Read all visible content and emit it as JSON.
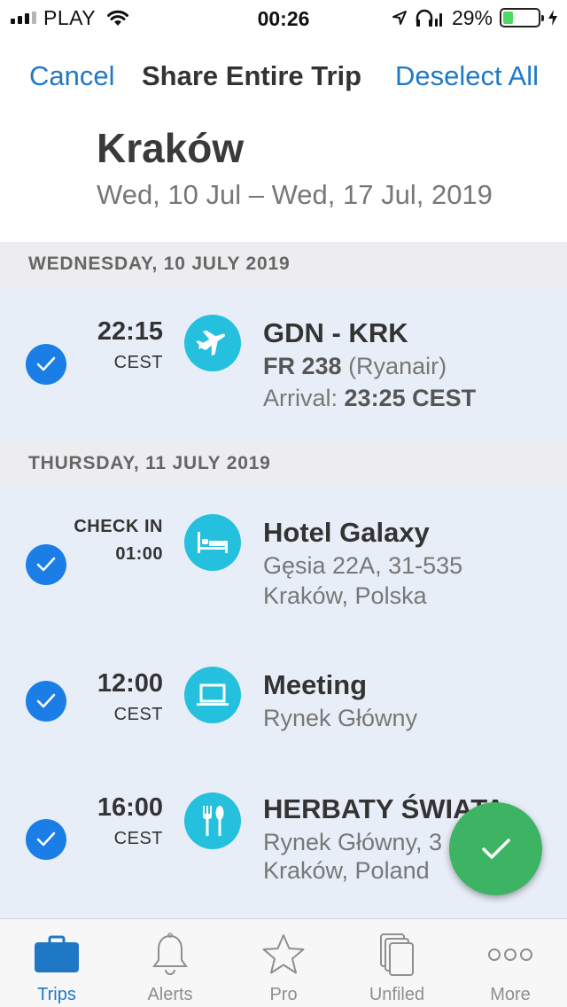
{
  "status_bar": {
    "carrier": "PLAY",
    "time": "00:26",
    "battery_percent": "29%",
    "battery_level": 0.29,
    "battery_color": "#4cd964"
  },
  "nav": {
    "cancel_label": "Cancel",
    "title": "Share Entire Trip",
    "deselect_label": "Deselect All",
    "accent_color": "#2079c7"
  },
  "trip": {
    "title": "Kraków",
    "dates": "Wed, 10 Jul – Wed, 17 Jul, 2019"
  },
  "days": [
    {
      "header": "WEDNESDAY, 10 JULY 2019",
      "items": [
        {
          "selected": true,
          "time": "22:15",
          "time_sub": "CEST",
          "icon": "airplane-icon",
          "title": "GDN - KRK",
          "flight_number": "FR 238",
          "airline": "(Ryanair)",
          "arrival_label": "Arrival:",
          "arrival_time": "23:25 CEST"
        }
      ]
    },
    {
      "header": "THURSDAY, 11 JULY 2019",
      "items": [
        {
          "selected": true,
          "time_label": "CHECK IN",
          "time": "01:00",
          "icon": "bed-icon",
          "title": "Hotel Galaxy",
          "line1": "Gęsia 22A, 31-535",
          "line2": "Kraków, Polska"
        },
        {
          "selected": true,
          "time": "12:00",
          "time_sub": "CEST",
          "icon": "laptop-icon",
          "title": "Meeting",
          "line1": "Rynek Główny"
        },
        {
          "selected": true,
          "time": "16:00",
          "time_sub": "CEST",
          "icon": "fork-spoon-icon",
          "title": "HERBATY ŚWIATA",
          "line1": "Rynek Główny, 3",
          "line2": "Kraków, Poland"
        }
      ]
    }
  ],
  "fab": {
    "icon": "checkmark-icon",
    "color": "#3db463"
  },
  "tabs": [
    {
      "label": "Trips",
      "icon": "suitcase-icon",
      "active": true
    },
    {
      "label": "Alerts",
      "icon": "bell-icon",
      "active": false
    },
    {
      "label": "Pro",
      "icon": "star-icon",
      "active": false
    },
    {
      "label": "Unfiled",
      "icon": "documents-icon",
      "active": false
    },
    {
      "label": "More",
      "icon": "more-dots-icon",
      "active": false
    }
  ]
}
